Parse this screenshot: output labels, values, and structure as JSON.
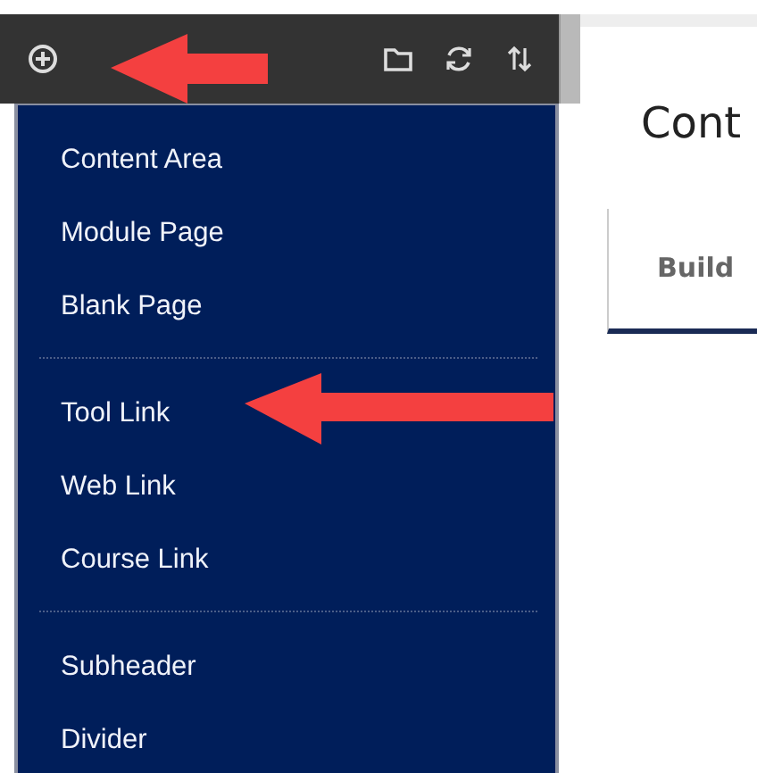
{
  "page": {
    "heading": "Cont",
    "tab": "Build"
  },
  "menu": {
    "groups": [
      {
        "items": [
          "Content Area",
          "Module Page",
          "Blank Page"
        ]
      },
      {
        "items": [
          "Tool Link",
          "Web Link",
          "Course Link"
        ]
      },
      {
        "items": [
          "Subheader",
          "Divider"
        ]
      }
    ]
  }
}
